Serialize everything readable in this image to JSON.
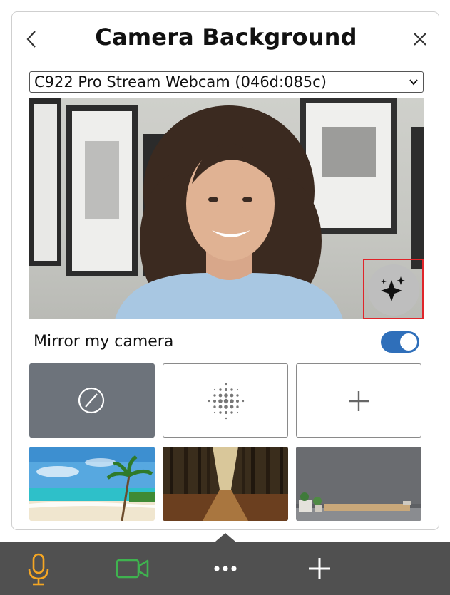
{
  "header": {
    "title": "Camera Background",
    "back_icon": "chevron-left-icon",
    "close_icon": "close-icon"
  },
  "camera_select": {
    "selected": "C922 Pro Stream Webcam (046d:085c)",
    "icon": "chevron-down-icon"
  },
  "preview": {
    "effects_button_icon": "sparkles-icon",
    "highlight_color": "#e0252a"
  },
  "mirror": {
    "label": "Mirror my camera",
    "enabled": true,
    "toggle_color": "#2f6fba"
  },
  "backgrounds": [
    {
      "kind": "none",
      "icon": "no-background-icon",
      "selected": true
    },
    {
      "kind": "blur",
      "icon": "blur-icon",
      "selected": false
    },
    {
      "kind": "add",
      "icon": "plus-icon",
      "selected": false
    },
    {
      "kind": "image",
      "icon": "beach-thumbnail",
      "selected": false
    },
    {
      "kind": "image",
      "icon": "forest-thumbnail",
      "selected": false
    },
    {
      "kind": "image",
      "icon": "living-room-thumbnail",
      "selected": false
    }
  ],
  "bottom_bar": {
    "items": [
      {
        "icon": "microphone-icon",
        "color": "#f5a623"
      },
      {
        "icon": "video-camera-icon",
        "color": "#3fb34f"
      },
      {
        "icon": "more-icon",
        "color": "#ffffff"
      },
      {
        "icon": "plus-icon",
        "color": "#ffffff"
      }
    ]
  }
}
